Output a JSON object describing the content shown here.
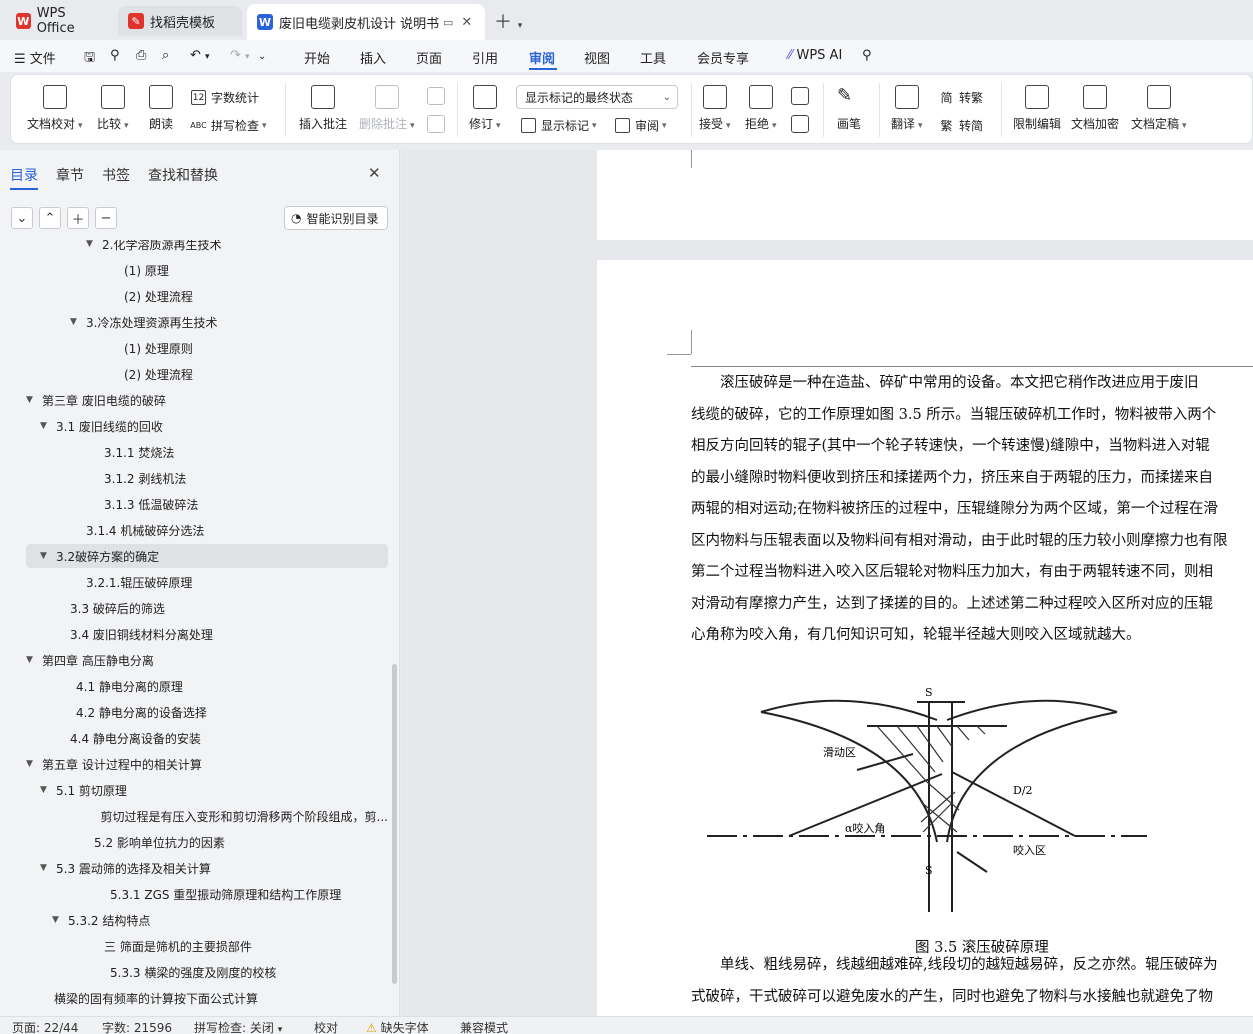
{
  "tabs": [
    {
      "label": "WPS Office"
    },
    {
      "label": "找稻壳模板"
    },
    {
      "label": "废旧电缆剥皮机设计 说明书（"
    }
  ],
  "menu": {
    "file": "文件",
    "items": [
      "开始",
      "插入",
      "页面",
      "引用",
      "审阅",
      "视图",
      "工具",
      "会员专享"
    ],
    "wps_ai": "WPS AI"
  },
  "ribbon": {
    "doc_proof": "文档校对",
    "compare": "比较",
    "read_aloud": "朗读",
    "word_count": "字数统计",
    "spell_check": "拼写检查",
    "insert_comment": "插入批注",
    "delete_comment": "删除批注",
    "revise": "修订",
    "markup_state": "显示标记的最终状态",
    "show_markup": "显示标记",
    "review": "审阅",
    "accept": "接受",
    "reject": "拒绝",
    "pen": "画笔",
    "translate": "翻译",
    "to_traditional": "转繁",
    "to_simplified": "转简",
    "restrict_edit": "限制编辑",
    "encrypt": "文档加密",
    "finalize": "文档定稿",
    "icon_word_count": "12",
    "icon_spell": "ABC",
    "icon_trad": "简",
    "icon_simp": "繁"
  },
  "nav": {
    "tabs": [
      "目录",
      "章节",
      "书签",
      "查找和替换"
    ],
    "smart_toc": "智能识别目录",
    "toc": [
      {
        "text": "2.化学溶质源再生技术",
        "indent": 60,
        "tri": "▼"
      },
      {
        "text": "(1) 原理",
        "indent": 82,
        "tri": ""
      },
      {
        "text": "(2) 处理流程",
        "indent": 82,
        "tri": ""
      },
      {
        "text": "3.冷冻处理资源再生技术",
        "indent": 44,
        "tri": "▼"
      },
      {
        "text": "(1) 处理原则",
        "indent": 82,
        "tri": ""
      },
      {
        "text": "(2) 处理流程",
        "indent": 82,
        "tri": ""
      },
      {
        "text": "第三章   废旧电缆的破碎",
        "indent": 0,
        "tri": "▼"
      },
      {
        "text": "3.1 废旧线缆的回收",
        "indent": 14,
        "tri": "▼"
      },
      {
        "text": "3.1.1 焚烧法",
        "indent": 62,
        "tri": ""
      },
      {
        "text": "3.1.2 剥线机法",
        "indent": 62,
        "tri": ""
      },
      {
        "text": "3.1.3 低温破碎法",
        "indent": 62,
        "tri": ""
      },
      {
        "text": "3.1.4 机械破碎分选法",
        "indent": 44,
        "tri": ""
      },
      {
        "text": "3.2破碎方案的确定",
        "indent": 14,
        "tri": "▼"
      },
      {
        "text": "3.2.1.辊压破碎原理",
        "indent": 44,
        "tri": ""
      },
      {
        "text": "3.3 破碎后的筛选",
        "indent": 28,
        "tri": ""
      },
      {
        "text": "3.4 废旧铜线材料分离处理",
        "indent": 28,
        "tri": ""
      },
      {
        "text": "第四章   高压静电分离",
        "indent": 0,
        "tri": "▼"
      },
      {
        "text": "4.1 静电分离的原理",
        "indent": 34,
        "tri": ""
      },
      {
        "text": "4.2 静电分离的设备选择",
        "indent": 34,
        "tri": ""
      },
      {
        "text": "4.4 静电分离设备的安装",
        "indent": 28,
        "tri": ""
      },
      {
        "text": "第五章  设计过程中的相关计算",
        "indent": 0,
        "tri": "▼"
      },
      {
        "text": "5.1 剪切原理",
        "indent": 14,
        "tri": "▼"
      },
      {
        "text": "剪切过程是有压入变形和剪切滑移两个阶段组成，剪...",
        "indent": 62,
        "tri": ""
      },
      {
        "text": "5.2 影响单位抗力的因素",
        "indent": 52,
        "tri": ""
      },
      {
        "text": "5.3 震动筛的选择及相关计算",
        "indent": 14,
        "tri": "▼"
      },
      {
        "text": "5.3.1   ZGS 重型振动筛原理和结构工作原理",
        "indent": 68,
        "tri": ""
      },
      {
        "text": "5.3.2  结构特点",
        "indent": 26,
        "tri": "▼"
      },
      {
        "text": "三   筛面是筛机的主要损部件",
        "indent": 62,
        "tri": ""
      },
      {
        "text": "5.3.3  横梁的强度及刚度的校核",
        "indent": 68,
        "tri": ""
      },
      {
        "text": "横梁的固有频率的计算按下面公式计算",
        "indent": 12,
        "tri": ""
      }
    ]
  },
  "doc": {
    "para1": [
      "　　滚压破碎是一种在造盐、碎矿中常用的设备。本文把它稍作改进应用于废旧",
      "线缆的破碎，它的工作原理如图 3.5 所示。当辊压破碎机工作时，物料被带入两个",
      "相反方向回转的辊子(其中一个轮子转速快，一个转速慢)缝隙中，当物料进入对辊",
      "的最小缝隙时物料便收到挤压和揉搓两个力，挤压来自于两辊的压力，而揉搓来自",
      "两辊的相对运动;在物料被挤压的过程中，压辊缝隙分为两个区域，第一个过程在滑",
      "区内物料与压辊表面以及物料间有相对滑动，由于此时辊的压力较小则摩擦力也有限",
      "第二个过程当物料进入咬入区后辊轮对物料压力加大，有由于两辊转速不同，则相",
      "对滑动有摩擦力产生，达到了揉搓的目的。上述述第二种过程咬入区所对应的压辊",
      "心角称为咬入角，有几何知识可知，轮辊半径越大则咬入区域就越大。"
    ],
    "figure": {
      "label_s_top": "S",
      "label_s_bottom": "S",
      "label_slide": "滑动区",
      "label_radius": "D/2",
      "label_angle": "α咬入角",
      "label_bite": "咬入区"
    },
    "caption": "图 3.5  滚压破碎原理",
    "para2": [
      "　　单线、粗线易碎，线越细越难碎,线段切的越短越易碎，反之亦然。辊压破碎为",
      "式破碎，干式破碎可以避免废水的产生，同时也避免了物料与水接触也就避免了物"
    ]
  },
  "status": {
    "page": "页面: 22/44",
    "words": "字数: 21596",
    "spell": "拼写检查: 关闭",
    "proof": "校对",
    "missing_font": "缺失字体",
    "compat": "兼容模式"
  },
  "colors": {
    "accent": "#2a62d9",
    "wps_red": "#e0332d"
  }
}
